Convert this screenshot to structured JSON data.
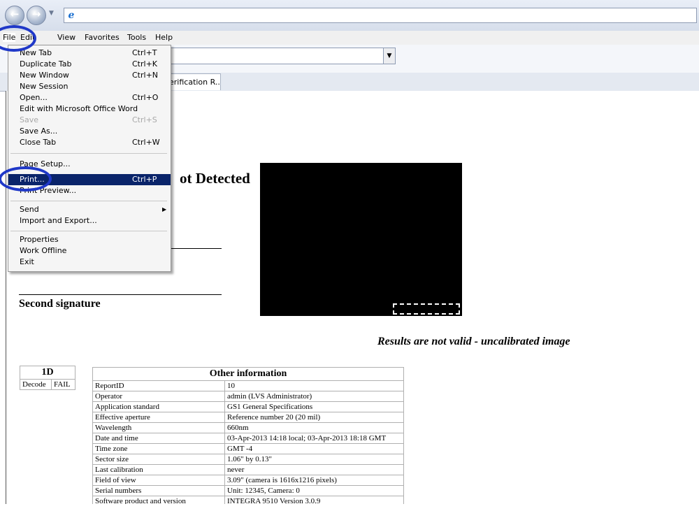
{
  "menubar": {
    "items": [
      "File",
      "Edit",
      "View",
      "Favorites",
      "Tools",
      "Help"
    ]
  },
  "tab": {
    "label": "erification R..."
  },
  "file_menu": {
    "items": [
      {
        "label": "New Tab",
        "shortcut": "Ctrl+T"
      },
      {
        "label": "Duplicate Tab",
        "shortcut": "Ctrl+K"
      },
      {
        "label": "New Window",
        "shortcut": "Ctrl+N"
      },
      {
        "label": "New Session",
        "shortcut": ""
      },
      {
        "label": "Open...",
        "shortcut": "Ctrl+O"
      },
      {
        "label": "Edit with Microsoft Office Word",
        "shortcut": ""
      },
      {
        "label": "Save",
        "shortcut": "Ctrl+S"
      },
      {
        "label": "Save As...",
        "shortcut": ""
      },
      {
        "label": "Close Tab",
        "shortcut": "Ctrl+W"
      },
      {
        "label": "Page Setup...",
        "shortcut": ""
      },
      {
        "label": "Print...",
        "shortcut": "Ctrl+P"
      },
      {
        "label": "Print Preview...",
        "shortcut": ""
      },
      {
        "label": "Send",
        "shortcut": ""
      },
      {
        "label": "Import and Export...",
        "shortcut": ""
      },
      {
        "label": "Properties",
        "shortcut": ""
      },
      {
        "label": "Work Offline",
        "shortcut": ""
      },
      {
        "label": "Exit",
        "shortcut": ""
      }
    ]
  },
  "report": {
    "heading": "ot Detected",
    "second_signature": "Second signature",
    "warning": "Results are not valid - uncalibrated image"
  },
  "table_1d": {
    "title": "1D",
    "decode_label": "Decode",
    "decode_value": "FAIL"
  },
  "other_info": {
    "title": "Other information",
    "rows": [
      {
        "k": "ReportID",
        "v": "10"
      },
      {
        "k": "Operator",
        "v": "admin (LVS Administrator)"
      },
      {
        "k": "Application standard",
        "v": "GS1 General Specifications"
      },
      {
        "k": "Effective aperture",
        "v": "Reference number 20 (20 mil)"
      },
      {
        "k": "Wavelength",
        "v": "660nm"
      },
      {
        "k": "Date and time",
        "v": "03-Apr-2013 14:18 local; 03-Apr-2013 18:18 GMT"
      },
      {
        "k": "Time zone",
        "v": "GMT -4"
      },
      {
        "k": "Sector size",
        "v": "1.06\" by 0.13\""
      },
      {
        "k": "Last calibration",
        "v": "never"
      },
      {
        "k": "Field of view",
        "v": "3.09\" (camera is 1616x1216 pixels)"
      },
      {
        "k": "Serial numbers",
        "v": "Unit: 12345, Camera: 0"
      },
      {
        "k": "Software product and version",
        "v": "INTEGRA 9510 Version 3.0.9"
      }
    ]
  }
}
